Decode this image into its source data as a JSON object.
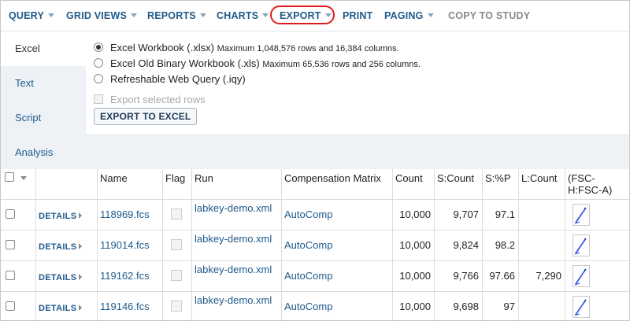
{
  "toolbar": {
    "query": "QUERY",
    "grid_views": "GRID VIEWS",
    "reports": "REPORTS",
    "charts": "CHARTS",
    "export": "EXPORT",
    "print": "PRINT",
    "paging": "PAGING",
    "copy_to_study": "COPY TO STUDY"
  },
  "colors": {
    "accent": "#1f5a8a",
    "highlight_ring": "#e01b1b",
    "panel_bg": "#eef2f7"
  },
  "export_panel": {
    "tabs": [
      "Excel",
      "Text",
      "Script",
      "Analysis"
    ],
    "active_tab": "Excel",
    "options": [
      {
        "label": "Excel Workbook (.xlsx)",
        "note": "Maximum 1,048,576 rows and 16,384 columns.",
        "selected": true
      },
      {
        "label": "Excel Old Binary Workbook (.xls)",
        "note": "Maximum 65,536 rows and 256 columns.",
        "selected": false
      },
      {
        "label": "Refreshable Web Query (.iqy)",
        "note": "",
        "selected": false
      }
    ],
    "export_selected_rows": "Export selected rows",
    "export_button": "EXPORT TO EXCEL"
  },
  "grid": {
    "columns": [
      "Name",
      "Flag",
      "Run",
      "Compensation Matrix",
      "Count",
      "S:Count",
      "S:%P",
      "L:Count",
      "(FSC-H:FSC-A)"
    ],
    "details_label": "DETAILS",
    "rows": [
      {
        "name": "118969.fcs",
        "run": "labkey-demo.xml",
        "comp": "AutoComp",
        "count": "10,000",
        "s_count": "9,707",
        "s_p": "97.1",
        "l_count": ""
      },
      {
        "name": "119014.fcs",
        "run": "labkey-demo.xml",
        "comp": "AutoComp",
        "count": "10,000",
        "s_count": "9,824",
        "s_p": "98.2",
        "l_count": ""
      },
      {
        "name": "119162.fcs",
        "run": "labkey-demo.xml",
        "comp": "AutoComp",
        "count": "10,000",
        "s_count": "9,766",
        "s_p": "97.66",
        "l_count": "7,290"
      },
      {
        "name": "119146.fcs",
        "run": "labkey-demo.xml",
        "comp": "AutoComp",
        "count": "10,000",
        "s_count": "9,698",
        "s_p": "97",
        "l_count": ""
      }
    ]
  }
}
